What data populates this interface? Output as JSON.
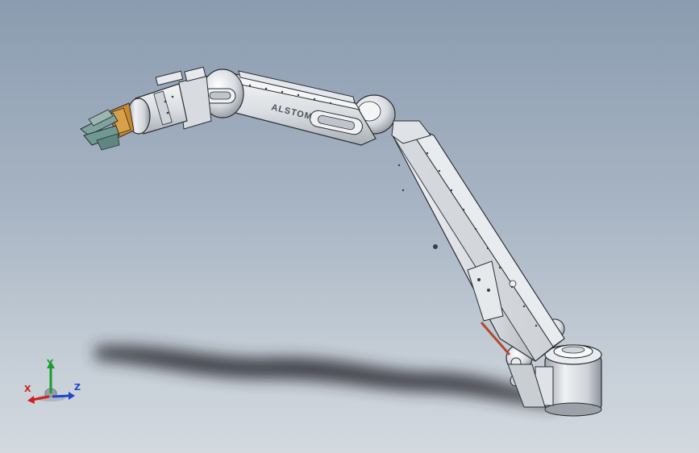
{
  "scene": {
    "model_name": "ALSTOM",
    "model_subtitle": "",
    "colors": {
      "background_top": "#8b9cb0",
      "background_bottom": "#d3d9df",
      "metal_light": "#eef0f2",
      "metal_mid": "#c7ccd2",
      "metal_dark": "#8a9098",
      "outline": "#2a2d31",
      "shadow": "#2a2c30",
      "gripper_orange": "#c9892e",
      "gripper_teal": "#6f9a94",
      "cable_red": "#b4492f"
    }
  },
  "triad": {
    "x_label": "X",
    "y_label": "Y",
    "z_label": "Z",
    "colors": {
      "x": "#d21e1e",
      "y": "#1a9c2e",
      "z": "#1e46c8"
    }
  }
}
